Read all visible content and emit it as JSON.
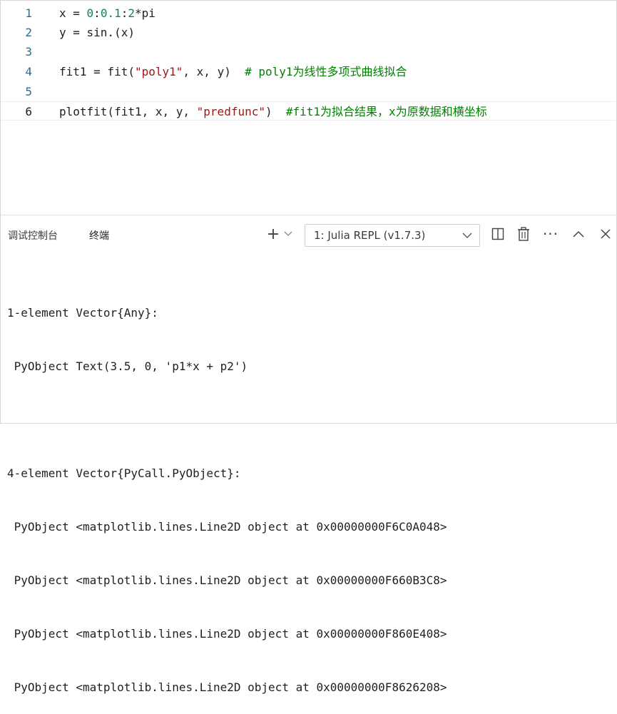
{
  "editor": {
    "lines": [
      {
        "num": "1",
        "code": "x = 0:0.1:2*pi"
      },
      {
        "num": "2",
        "code": "y = sin.(x)"
      },
      {
        "num": "3",
        "code": ""
      },
      {
        "num": "4",
        "code_prefix": "fit1 = fit(",
        "code_str": "\"poly1\"",
        "code_mid": ", x, y)  ",
        "comment": "# poly1为线性多项式曲线拟合"
      },
      {
        "num": "5",
        "code": ""
      },
      {
        "num": "6",
        "code_prefix": "plotfit(fit1, x, y, ",
        "code_str": "\"predfunc\"",
        "code_mid": ")  ",
        "comment": "#fit1为拟合结果，x为原数据和横坐标"
      }
    ]
  },
  "panel": {
    "tabs": [
      "调试控制台",
      "终端"
    ],
    "terminal_select": "1: Julia REPL (v1.7.3)",
    "icons": [
      "plus-icon",
      "chevron-down-icon",
      "split-icon",
      "trash-icon",
      "more-icon",
      "chevron-up-icon",
      "close-icon"
    ]
  },
  "terminal": {
    "lines": [
      "1-element Vector{Any}:",
      " PyObject Text(3.5, 0, 'p1*x + p2')",
      "",
      "4-element Vector{PyCall.PyObject}:",
      " PyObject <matplotlib.lines.Line2D object at 0x00000000F6C0A048>",
      " PyObject <matplotlib.lines.Line2D object at 0x00000000F660B3C8>",
      " PyObject <matplotlib.lines.Line2D object at 0x00000000F860E408>",
      " PyObject <matplotlib.lines.Line2D object at 0x00000000F8626208>"
    ]
  }
}
